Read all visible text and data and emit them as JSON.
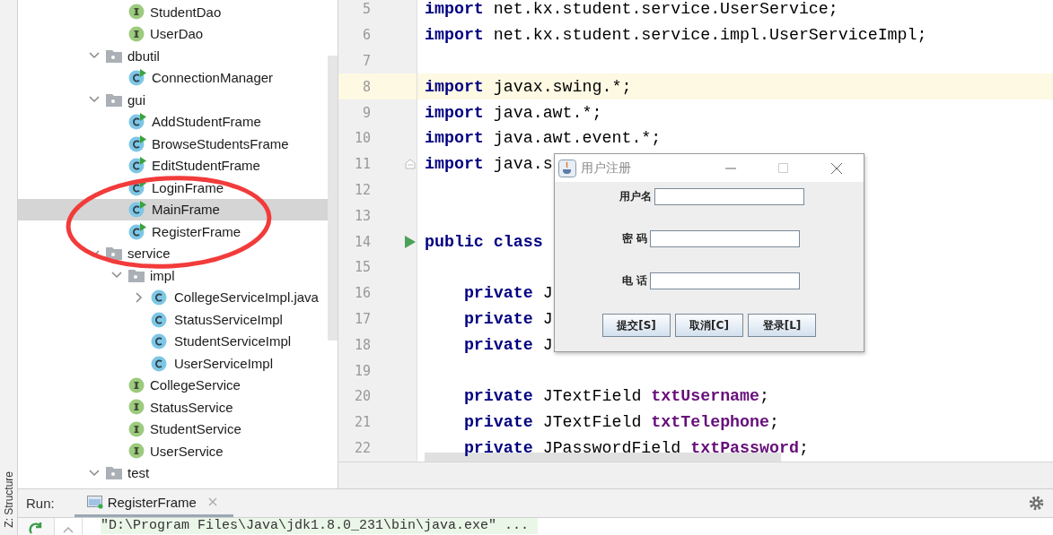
{
  "side_strip": {
    "label": "Z: Structure"
  },
  "project_tree": {
    "items": [
      {
        "kind": "scrolled",
        "children": [
          {
            "kind": "interface",
            "label": "StudentDao",
            "selected": false
          },
          {
            "kind": "interface",
            "label": "UserDao",
            "selected": false
          }
        ]
      },
      {
        "kind": "folder",
        "label": "dbutil",
        "expanded": true,
        "selected": false,
        "children": [
          {
            "kind": "class-runnable",
            "label": "ConnectionManager",
            "selected": false
          }
        ]
      },
      {
        "kind": "folder",
        "label": "gui",
        "expanded": true,
        "selected": false,
        "children": [
          {
            "kind": "class-runnable",
            "label": "AddStudentFrame",
            "selected": false
          },
          {
            "kind": "class-runnable",
            "label": "BrowseStudentsFrame",
            "selected": false
          },
          {
            "kind": "class-runnable",
            "label": "EditStudentFrame",
            "selected": false
          },
          {
            "kind": "class-runnable",
            "label": "LoginFrame",
            "selected": false
          },
          {
            "kind": "class-runnable",
            "label": "MainFrame",
            "selected": true
          },
          {
            "kind": "class-runnable",
            "label": "RegisterFrame",
            "selected": false
          }
        ]
      },
      {
        "kind": "folder",
        "label": "service",
        "expanded": true,
        "selected": false,
        "children": [
          {
            "kind": "folder",
            "label": "impl",
            "expanded": true,
            "selected": false,
            "children": [
              {
                "kind": "class",
                "label": "CollegeServiceImpl.java",
                "expanded": false,
                "selected": false
              },
              {
                "kind": "class",
                "label": "StatusServiceImpl",
                "selected": false
              },
              {
                "kind": "class",
                "label": "StudentServiceImpl",
                "selected": false
              },
              {
                "kind": "class",
                "label": "UserServiceImpl",
                "selected": false
              }
            ]
          },
          {
            "kind": "interface",
            "label": "CollegeService",
            "selected": false
          },
          {
            "kind": "interface",
            "label": "StatusService",
            "selected": false
          },
          {
            "kind": "interface",
            "label": "StudentService",
            "selected": false
          },
          {
            "kind": "interface",
            "label": "UserService",
            "selected": false
          }
        ]
      },
      {
        "kind": "folder",
        "label": "test",
        "expanded": true,
        "selected": false
      }
    ]
  },
  "annotation": {
    "kind": "ellipse"
  },
  "editor": {
    "lines": [
      {
        "number": "5",
        "current": false,
        "tokens": [
          {
            "kind": "keyword",
            "text": "import"
          },
          {
            "kind": "plain",
            "text": " net.kx.student.service.UserService;"
          }
        ]
      },
      {
        "number": "6",
        "current": false,
        "tokens": [
          {
            "kind": "keyword",
            "text": "import"
          },
          {
            "kind": "plain",
            "text": " net.kx.student.service.impl.UserServiceImpl;"
          }
        ]
      },
      {
        "number": "7",
        "current": false
      },
      {
        "number": "8",
        "current": true,
        "tokens": [
          {
            "kind": "keyword",
            "text": "import"
          },
          {
            "kind": "plain",
            "text": " javax.swing.*;"
          }
        ]
      },
      {
        "number": "9",
        "current": false,
        "tokens": [
          {
            "kind": "keyword",
            "text": "import"
          },
          {
            "kind": "plain",
            "text": " java.awt.*;"
          }
        ]
      },
      {
        "number": "10",
        "current": false,
        "tokens": [
          {
            "kind": "keyword",
            "text": "import"
          },
          {
            "kind": "plain",
            "text": " java.awt.event.*;"
          }
        ]
      },
      {
        "number": "11",
        "current": false,
        "kind": "fold",
        "tokens": [
          {
            "kind": "keyword",
            "text": "import"
          },
          {
            "kind": "plain",
            "text": " java.s"
          }
        ]
      },
      {
        "number": "12",
        "current": false
      },
      {
        "number": "13",
        "current": false
      },
      {
        "number": "14",
        "current": false,
        "kind": "run",
        "tokens": [
          {
            "kind": "keyword",
            "text": "public class"
          }
        ]
      },
      {
        "number": "15",
        "current": false
      },
      {
        "number": "16",
        "current": false,
        "tokens": [
          {
            "kind": "keyword",
            "text": "    private"
          },
          {
            "kind": "plain",
            "text": " J"
          }
        ]
      },
      {
        "number": "17",
        "current": false,
        "tokens": [
          {
            "kind": "keyword",
            "text": "    private"
          },
          {
            "kind": "plain",
            "text": " J"
          }
        ]
      },
      {
        "number": "18",
        "current": false,
        "tokens": [
          {
            "kind": "keyword",
            "text": "    private"
          },
          {
            "kind": "plain",
            "text": " J"
          }
        ]
      },
      {
        "number": "19",
        "current": false
      },
      {
        "number": "20",
        "current": false,
        "tokens": [
          {
            "kind": "keyword",
            "text": "    private"
          },
          {
            "kind": "plain",
            "text": " JTextField "
          },
          {
            "kind": "field",
            "text": "txtUsername"
          },
          {
            "kind": "plain",
            "text": ";"
          }
        ]
      },
      {
        "number": "21",
        "current": false,
        "tokens": [
          {
            "kind": "keyword",
            "text": "    private"
          },
          {
            "kind": "plain",
            "text": " JTextField "
          },
          {
            "kind": "field",
            "text": "txtTelephone"
          },
          {
            "kind": "plain",
            "text": ";"
          }
        ]
      },
      {
        "number": "22",
        "current": false,
        "tokens": [
          {
            "kind": "keyword",
            "text": "    private"
          },
          {
            "kind": "plain",
            "text": " JPasswordField "
          },
          {
            "kind": "field",
            "text": "txtPassword"
          },
          {
            "kind": "plain",
            "text": ";"
          }
        ]
      }
    ]
  },
  "dialog": {
    "title": "用户注册",
    "fields": [
      {
        "label": "用户名"
      },
      {
        "label": "密 码"
      },
      {
        "label": "电 话"
      }
    ],
    "buttons": [
      "提交[S]",
      "取消[C]",
      "登录[L]"
    ]
  },
  "run_bar": {
    "label": "Run:",
    "tabs": [
      {
        "label": "RegisterFrame",
        "selected": true
      }
    ]
  },
  "console": {
    "lines": [
      "\"D:\\Program Files\\Java\\jdk1.8.0_231\\bin\\java.exe\" ..."
    ]
  }
}
